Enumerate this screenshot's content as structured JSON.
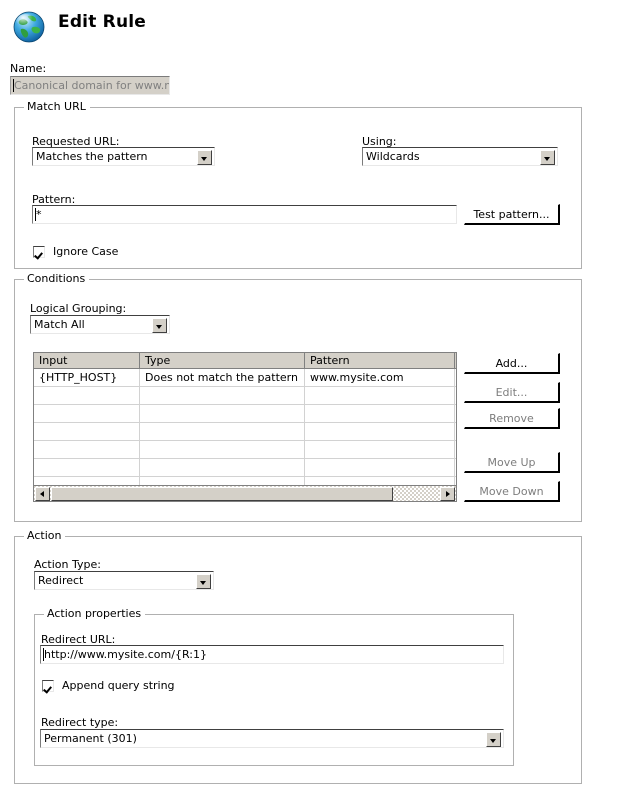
{
  "window": {
    "title": "Edit Rule",
    "icon": "globe-icon"
  },
  "name_field": {
    "label": "Name:",
    "value": "Canonical domain for www.mysil",
    "disabled": true
  },
  "match_url": {
    "legend": "Match URL",
    "requested_url_label": "Requested URL:",
    "requested_url_value": "Matches the pattern",
    "using_label": "Using:",
    "using_value": "Wildcards",
    "pattern_label": "Pattern:",
    "pattern_value": "*",
    "test_pattern_button": "Test pattern...",
    "ignore_case_label": "Ignore Case",
    "ignore_case_checked": true
  },
  "conditions": {
    "legend": "Conditions",
    "logical_grouping_label": "Logical Grouping:",
    "logical_grouping_value": "Match All",
    "columns": [
      "Input",
      "Type",
      "Pattern"
    ],
    "rows": [
      {
        "input": "{HTTP_HOST}",
        "type": "Does not match the pattern",
        "pattern": "www.mysite.com"
      }
    ],
    "empty_row_count": 6,
    "buttons": [
      {
        "label": "Add...",
        "enabled": true
      },
      {
        "label": "Edit...",
        "enabled": false
      },
      {
        "label": "Remove",
        "enabled": false
      },
      {
        "label": "Move Up",
        "enabled": false
      },
      {
        "label": "Move Down",
        "enabled": false
      }
    ]
  },
  "action": {
    "legend": "Action",
    "action_type_label": "Action Type:",
    "action_type_value": "Redirect",
    "properties": {
      "legend": "Action properties",
      "redirect_url_label": "Redirect URL:",
      "redirect_url_value": "http://www.mysite.com/{R:1}",
      "append_query_string_label": "Append query string",
      "append_query_string_checked": true,
      "redirect_type_label": "Redirect type:",
      "redirect_type_value": "Permanent (301)"
    }
  },
  "colors": {
    "window_background": "#ffffff",
    "control_face": "#d4d0c8",
    "group_border": "#b0b0b0",
    "disabled_text": "#808080",
    "header_background": "#d4d0c8"
  }
}
